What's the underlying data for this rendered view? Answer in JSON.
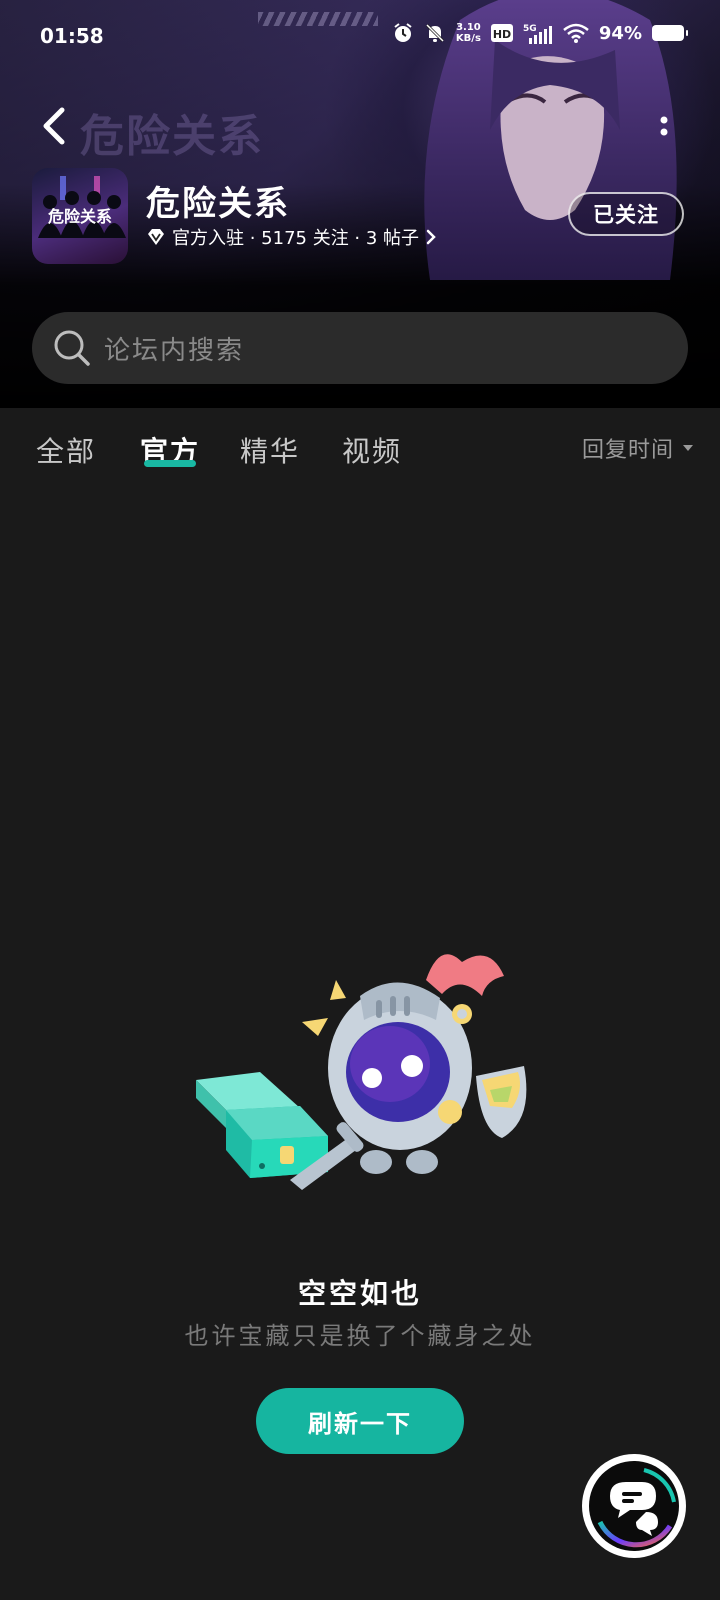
{
  "status_bar": {
    "time": "01:58",
    "net_speed_value": "3.10",
    "net_speed_unit": "KB/s",
    "hd_label": "HD",
    "network": "5G",
    "battery": "94%"
  },
  "header": {
    "forum_name": "危险关系",
    "background_logo_text": "危险关系",
    "meta_text": "官方入驻 · 5175 关注 · 3 帖子",
    "follow_button": "已关注"
  },
  "search": {
    "placeholder": "论坛内搜索"
  },
  "tabs": [
    {
      "label": "全部",
      "active": false
    },
    {
      "label": "官方",
      "active": true
    },
    {
      "label": "精华",
      "active": false
    },
    {
      "label": "视频",
      "active": false
    }
  ],
  "sort": {
    "label": "回复时间"
  },
  "empty_state": {
    "title": "空空如也",
    "subtitle": "也许宝藏只是换了个藏身之处",
    "refresh_button": "刷新一下"
  },
  "colors": {
    "accent": "#16b5a0",
    "background": "#1a1a1a"
  }
}
